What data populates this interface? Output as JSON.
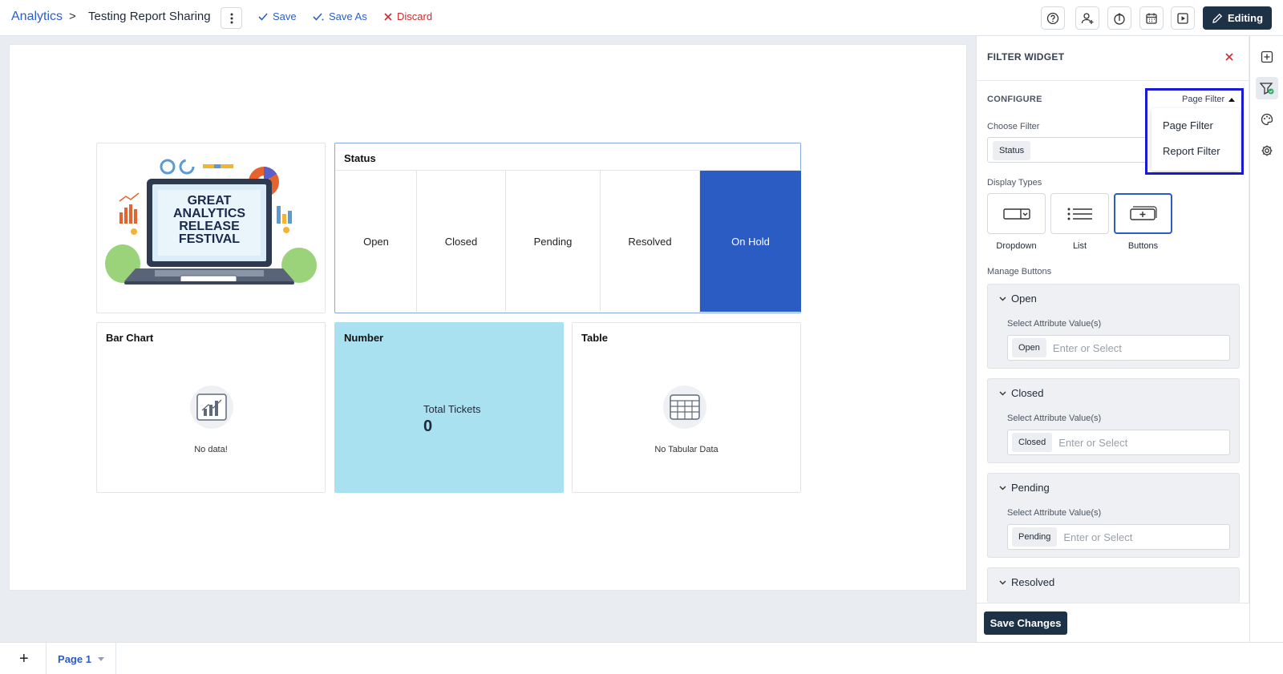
{
  "header": {
    "breadcrumb_root": "Analytics",
    "breadcrumb_sep": ">",
    "report_title": "Testing Report Sharing",
    "save_label": "Save",
    "save_as_label": "Save As",
    "discard_label": "Discard",
    "editing_label": "Editing",
    "icons": [
      "help-icon",
      "add-user-icon",
      "share-icon",
      "calendar-icon",
      "play-icon",
      "pencil-icon"
    ]
  },
  "canvas": {
    "image_widget": {
      "lines": [
        "GREAT",
        "ANALYTICS",
        "RELEASE",
        "FESTIVAL"
      ]
    },
    "status_widget": {
      "title": "Status",
      "buttons": [
        "Open",
        "Closed",
        "Pending",
        "Resolved",
        "On Hold"
      ],
      "active": "On Hold"
    },
    "bar_widget": {
      "title": "Bar Chart",
      "empty_text": "No data!"
    },
    "number_widget": {
      "title": "Number",
      "label": "Total Tickets",
      "value": "0"
    },
    "table_widget": {
      "title": "Table",
      "empty_text": "No Tabular Data"
    }
  },
  "panel": {
    "title": "FILTER WIDGET",
    "configure_label": "CONFIGURE",
    "filter_mode": "Page Filter",
    "filter_menu": [
      "Page Filter",
      "Report Filter"
    ],
    "choose_filter_label": "Choose Filter",
    "choose_filter_value": "Status",
    "display_types_label": "Display Types",
    "display_types": [
      "Dropdown",
      "List",
      "Buttons"
    ],
    "display_type_selected": "Buttons",
    "manage_buttons_label": "Manage Buttons",
    "manage_buttons": [
      {
        "name": "Open",
        "sub": "Select Attribute Value(s)",
        "chip": "Open",
        "placeholder": "Enter or Select"
      },
      {
        "name": "Closed",
        "sub": "Select Attribute Value(s)",
        "chip": "Closed",
        "placeholder": "Enter or Select"
      },
      {
        "name": "Pending",
        "sub": "Select Attribute Value(s)",
        "chip": "Pending",
        "placeholder": "Enter or Select"
      },
      {
        "name": "Resolved"
      }
    ],
    "save_changes_label": "Save Changes"
  },
  "rail": {
    "icons": [
      "add-widget-icon",
      "filter-icon",
      "palette-icon",
      "settings-icon"
    ]
  },
  "footer": {
    "add_label": "+",
    "page_tab": "Page 1"
  },
  "colors": {
    "accent": "#2b5cc4",
    "brand_dark": "#1e3247",
    "number_bg": "#a9e1f1",
    "danger": "#d02c2c"
  }
}
